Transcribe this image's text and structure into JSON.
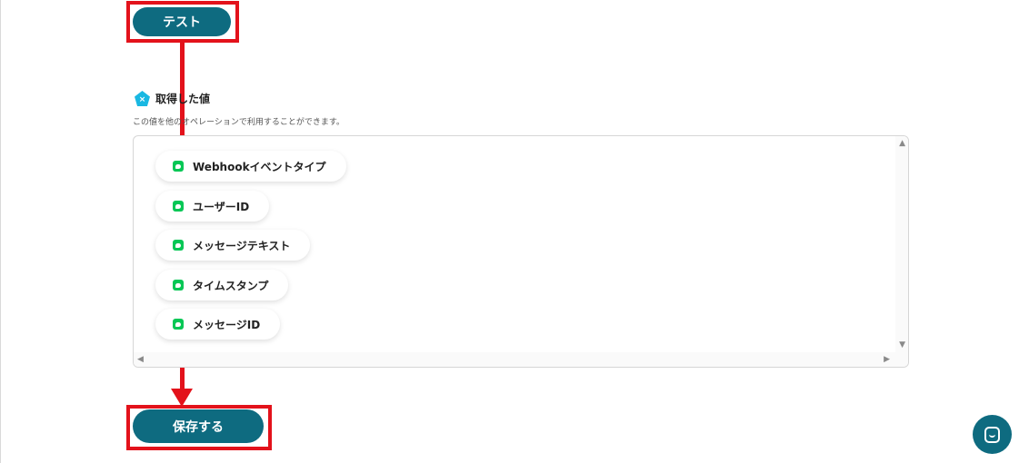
{
  "actions": {
    "test_label": "テスト",
    "save_label": "保存する"
  },
  "retrieved_values": {
    "icon": "x-pentagon-icon",
    "title": "取得した値",
    "description": "この値を他のオペレーションで利用することができます。",
    "items": [
      {
        "label": "Webhookイベントタイプ",
        "icon": "line-app-icon"
      },
      {
        "label": "ユーザーID",
        "icon": "line-app-icon"
      },
      {
        "label": "メッセージテキスト",
        "icon": "line-app-icon"
      },
      {
        "label": "タイムスタンプ",
        "icon": "line-app-icon"
      },
      {
        "label": "メッセージID",
        "icon": "line-app-icon"
      }
    ]
  },
  "scroll_arrows": {
    "up": "▲",
    "down": "▼",
    "left": "◀",
    "right": "▶"
  },
  "colors": {
    "primary": "#0e6b80",
    "highlight": "#e3121b",
    "line_green": "#06c755",
    "accent_cyan": "#19b8e2"
  }
}
